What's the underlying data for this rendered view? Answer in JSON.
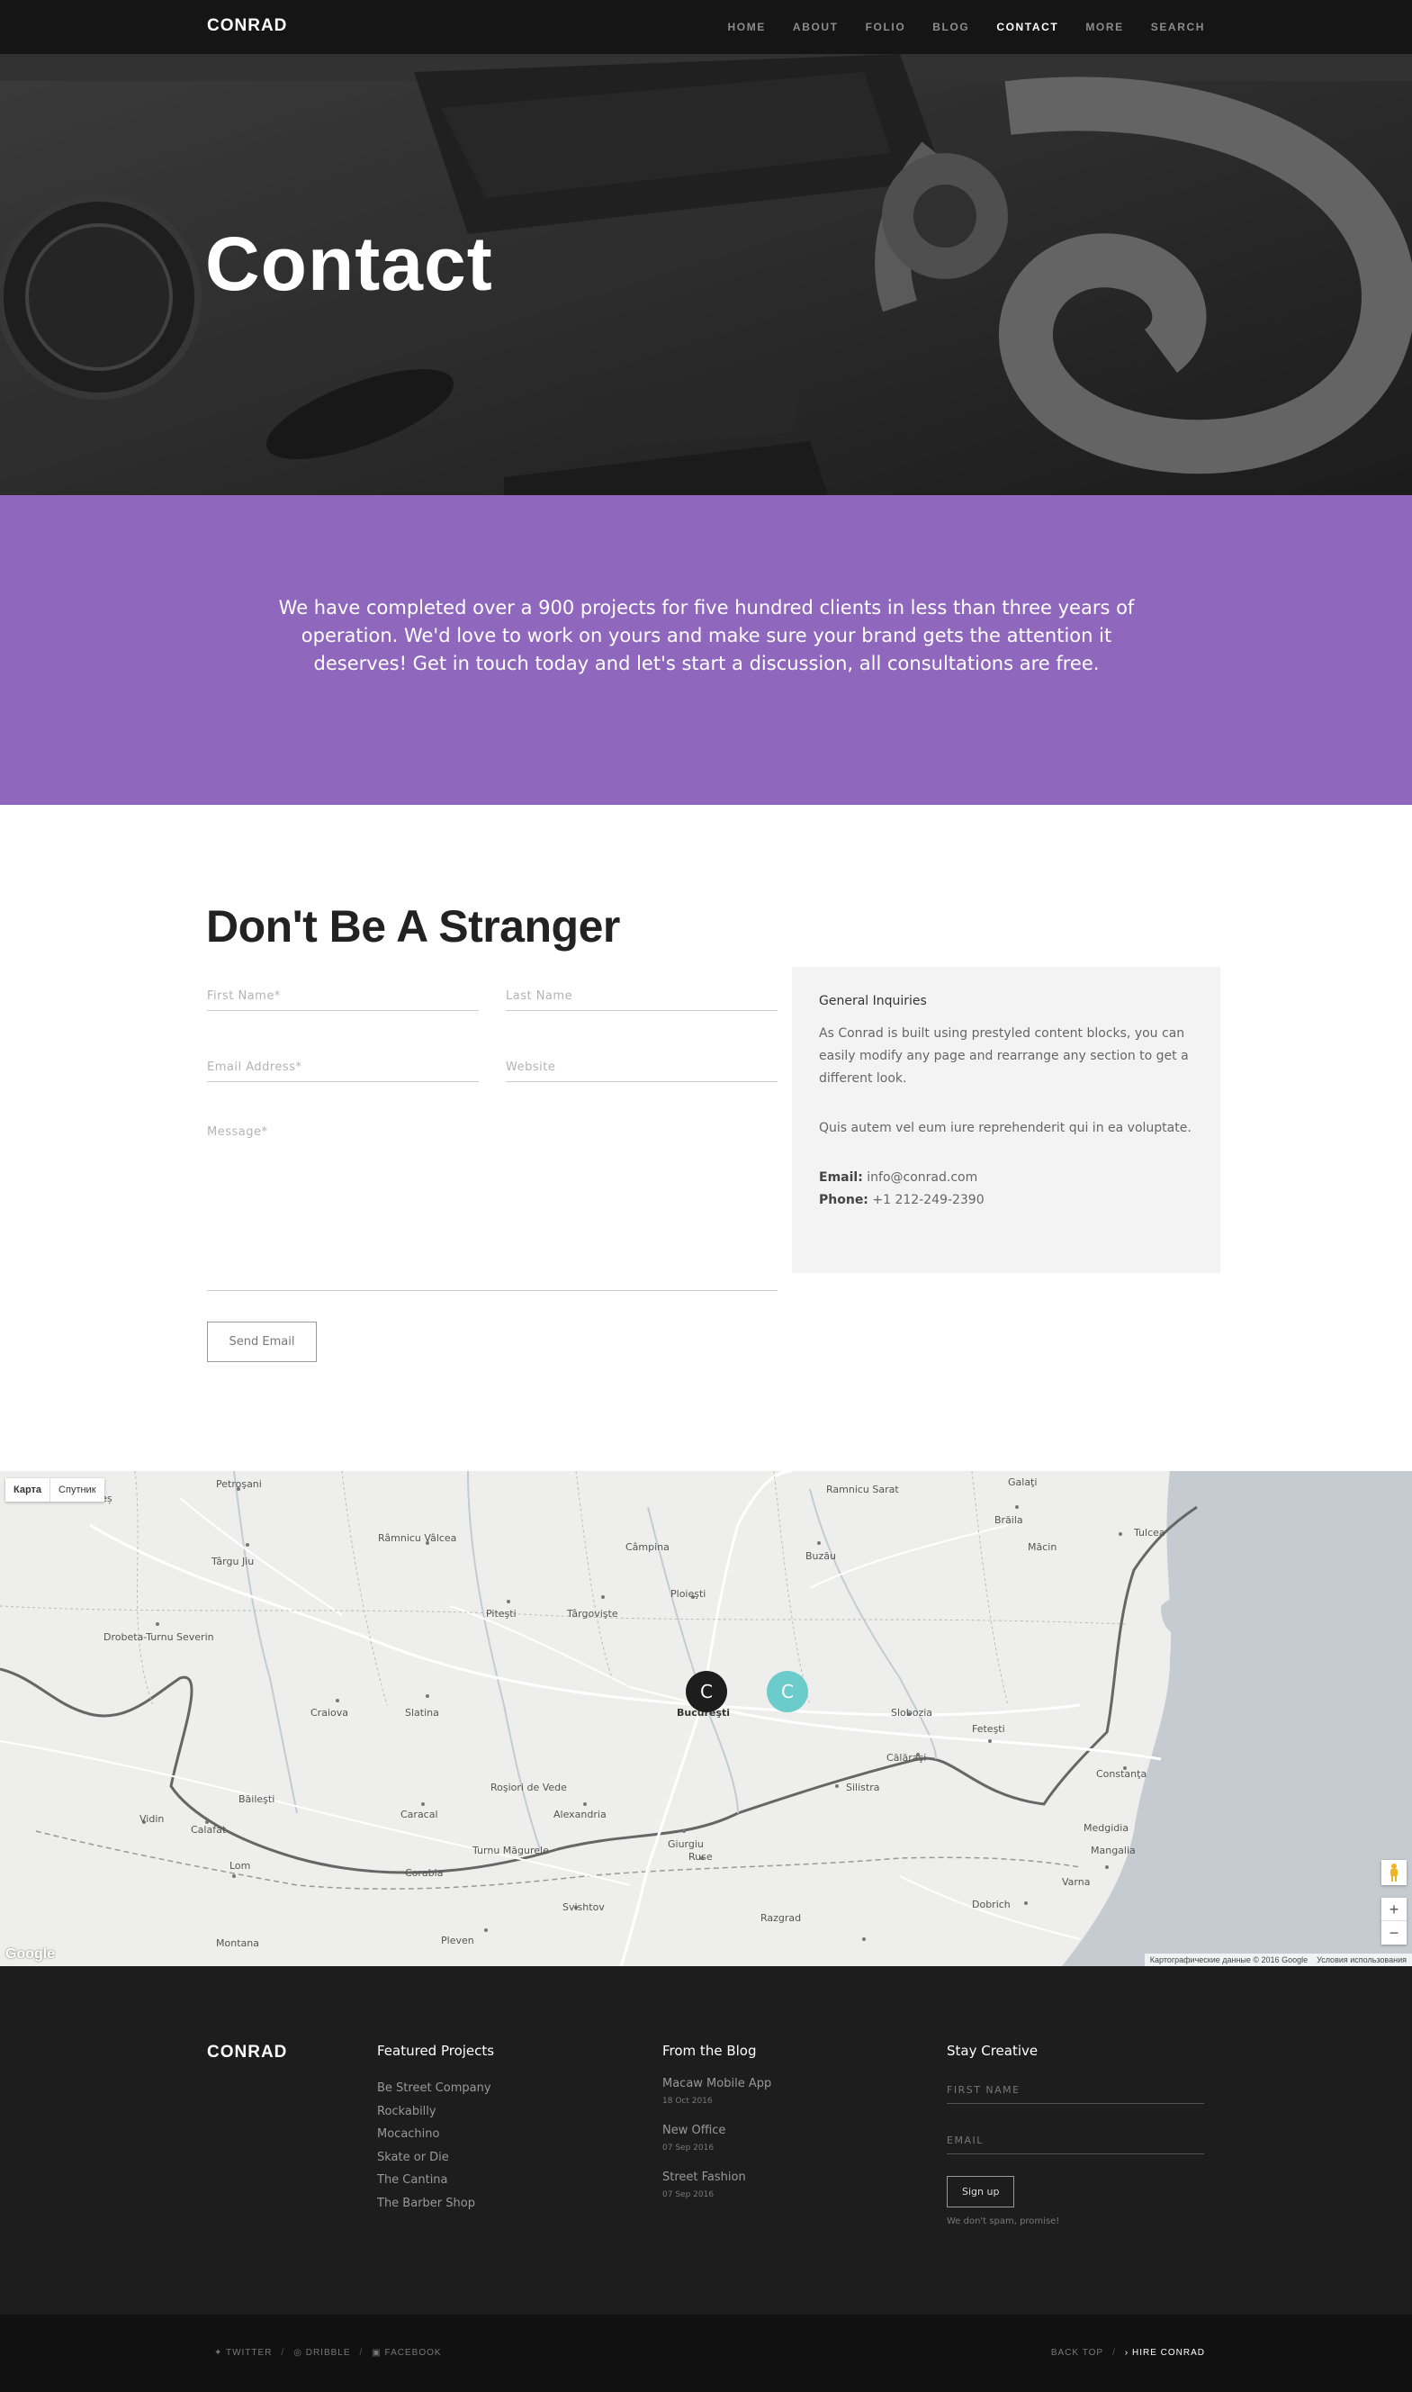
{
  "nav": {
    "logo": "CONRAD",
    "items": [
      "HOME",
      "ABOUT",
      "FOLIO",
      "BLOG",
      "CONTACT",
      "MORE",
      "SEARCH"
    ],
    "active": "CONTACT"
  },
  "hero": {
    "title": "Contact"
  },
  "intro": {
    "text": "We have completed over a 900 projects for five hundred clients in less than three years of operation. We'd love to work on yours and make sure your brand gets the attention it deserves! Get in touch today and let's start a discussion, all consultations are free."
  },
  "contact": {
    "title": "Don't Be A Stranger",
    "fields": {
      "first_name": "First Name*",
      "last_name": "Last Name",
      "email": "Email Address*",
      "website": "Website",
      "message": "Message*"
    },
    "send_label": "Send Email",
    "info": {
      "heading": "General Inquiries",
      "para1": "As Conrad is built using prestyled content blocks, you can easily modify any page and rearrange any section to get a different look.",
      "para2": "Quis autem vel eum iure reprehenderit qui in ea voluptate.",
      "email_label": "Email:",
      "email_value": "info@conrad.com",
      "phone_label": "Phone:",
      "phone_value": "+1 212-249-2390"
    }
  },
  "map": {
    "type_map": "Карта",
    "type_satellite": "Спутник",
    "zoom_in": "+",
    "zoom_out": "−",
    "attribution": "Картографические данные © 2016 Google",
    "terms": "Условия использования",
    "google_logo": "Google",
    "pin1": "C",
    "pin2": "C",
    "places": [
      "Petroşani",
      "Râmnicu Vâlcea",
      "Târgu Jiu",
      "Drobeta-Turnu Severin",
      "Craiova",
      "Slatina",
      "Piteşti",
      "Târgovişte",
      "Ploieşti",
      "Buzău",
      "Brăila",
      "Galaţi",
      "Tulcea",
      "Bucureşti",
      "Slobozia",
      "Călăraşi",
      "Feteşti",
      "Constanţa",
      "Mangalia",
      "Caracal",
      "Alexandria",
      "Giurgiu",
      "Ruse",
      "Svishtov",
      "Pleven",
      "Dobrich",
      "Varna",
      "Silistra",
      "Vidin",
      "Calafat",
      "Lom",
      "Razgrad",
      "Montana",
      "Caransebeș",
      "Câmpina",
      "Băileşti",
      "Corabia",
      "Turnu Măgurele",
      "Roşiori de Vede",
      "Ramnicu Sarat",
      "Măcin",
      "Medgidia"
    ]
  },
  "footer": {
    "logo": "CONRAD",
    "projects_title": "Featured Projects",
    "projects": [
      "Be Street Company",
      "Rockabilly",
      "Mocachino",
      "Skate or Die",
      "The Cantina",
      "The Barber Shop"
    ],
    "blog_title": "From the Blog",
    "blog": [
      {
        "title": "Macaw Mobile App",
        "date": "18 Oct 2016"
      },
      {
        "title": "New Office",
        "date": "07 Sep 2016"
      },
      {
        "title": "Street Fashion",
        "date": "07 Sep 2016"
      }
    ],
    "stay_title": "Stay Creative",
    "first_name_ph": "FIRST NAME",
    "email_ph": "EMAIL",
    "signup_label": "Sign up",
    "spam_note": "We don't spam, promise!"
  },
  "bottom": {
    "twitter": "TWITTER",
    "dribble": "DRIBBLE",
    "facebook": "FACEBOOK",
    "back_top": "BACK TOP",
    "hire": "HIRE CONRAD"
  },
  "colors": {
    "accent_purple": "#8f68be",
    "pin_dark": "#1d1d1d",
    "pin_teal": "#6bcccb",
    "footer_bg": "#1d1d1d"
  }
}
